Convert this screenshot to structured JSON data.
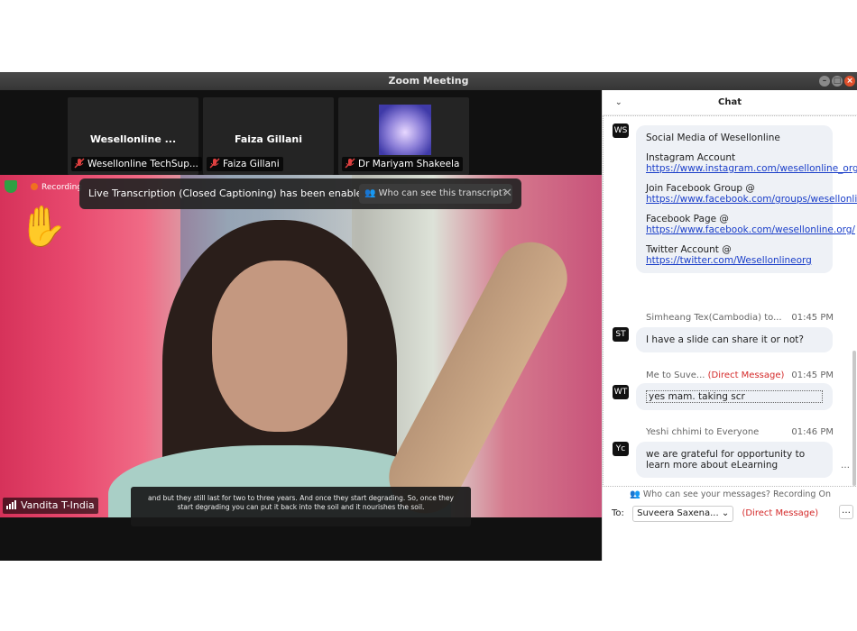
{
  "window": {
    "title": "Zoom Meeting"
  },
  "gallery": [
    {
      "title": "Wesellonline ...",
      "name": "Wesellonline TechSup..."
    },
    {
      "title": "Faiza Gillani",
      "name": "Faiza Gillani"
    },
    {
      "title": "",
      "name": "Dr Mariyam Shakeela"
    }
  ],
  "main": {
    "recording_label": "Recording",
    "banner_text": "Live Transcription (Closed Captioning) has been enabled",
    "banner_button": "Who can see this transcript?",
    "speaker_name": "Vandita T-India",
    "caption_text": "and but they still last for two to three years. And once they start degrading. So, once they start degrading you can put it back into the soil and it nourishes the soil."
  },
  "chat": {
    "header": "Chat",
    "messages": [
      {
        "initials": "WS",
        "lines": [
          {
            "text": "Social Media of Wesellonline"
          },
          {
            "text": "Instagram Account ",
            "link": "https://www.instagram.com/wesellonline_org/"
          },
          {
            "text": "Join Facebook Group @ ",
            "link": "https://www.facebook.com/groups/wesellonline/"
          },
          {
            "text": "Facebook Page @ ",
            "link": "https://www.facebook.com/wesellonline.org/"
          },
          {
            "text": "Twitter Account @ ",
            "link": "https://twitter.com/Wesellonlineorg"
          }
        ]
      },
      {
        "initials": "ST",
        "sender": "Simheang Tex(Cambodia) to...",
        "time": "01:45 PM",
        "text": "I have a slide can share it or not?"
      },
      {
        "initials": "WT",
        "sender": "Me to Suve...",
        "dm": "(Direct Message)",
        "time": "01:45 PM",
        "text": "yes mam. taking scr"
      },
      {
        "initials": "Yc",
        "sender": "Yeshi chhimi to Everyone",
        "time": "01:46 PM",
        "text": "we are grateful for opportunity to learn more about eLearning"
      }
    ],
    "who_can_see": "Who can see your messages? Recording On",
    "to_label": "To:",
    "to_value": "Suveera Saxena...",
    "to_dm": "(Direct Message)"
  },
  "colors": {
    "dm_red": "#d42a2a",
    "link_blue": "#1a3ec9",
    "mute_red": "#e04040"
  }
}
